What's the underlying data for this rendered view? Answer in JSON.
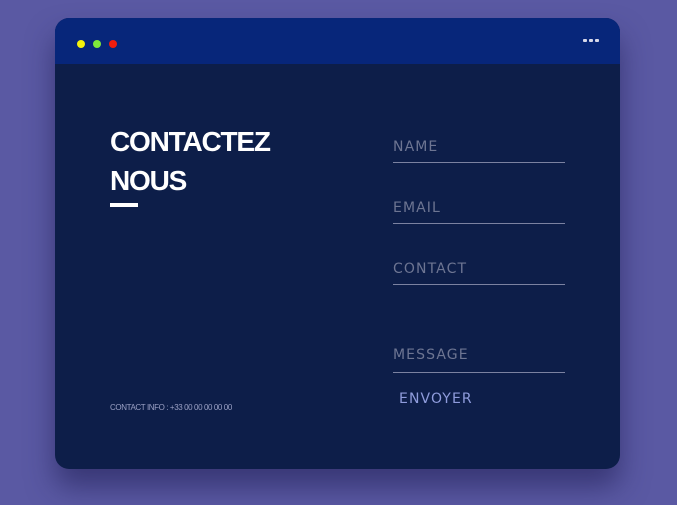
{
  "window": {
    "controls": [
      {
        "name": "minimize",
        "color": "#f6f20b"
      },
      {
        "name": "maximize",
        "color": "#7fe83a"
      },
      {
        "name": "close",
        "color": "#f11d0d"
      }
    ],
    "menu_icon": "more-horizontal-icon"
  },
  "contact": {
    "title_line1": "CONTACTEZ",
    "title_line2": "NOUS",
    "info": "CONTACT INFO : +33 00 00 00 00 00"
  },
  "form": {
    "name_placeholder": "NAME",
    "email_placeholder": "EMAIL",
    "contact_placeholder": "CONTACT",
    "message_placeholder": "MESSAGE",
    "submit_label": "ENVOYER"
  },
  "colors": {
    "page_background": "#5a59a3",
    "window_background": "#0d1e49",
    "titlebar_background": "#07267a",
    "submit_text": "#8f9cdc"
  }
}
